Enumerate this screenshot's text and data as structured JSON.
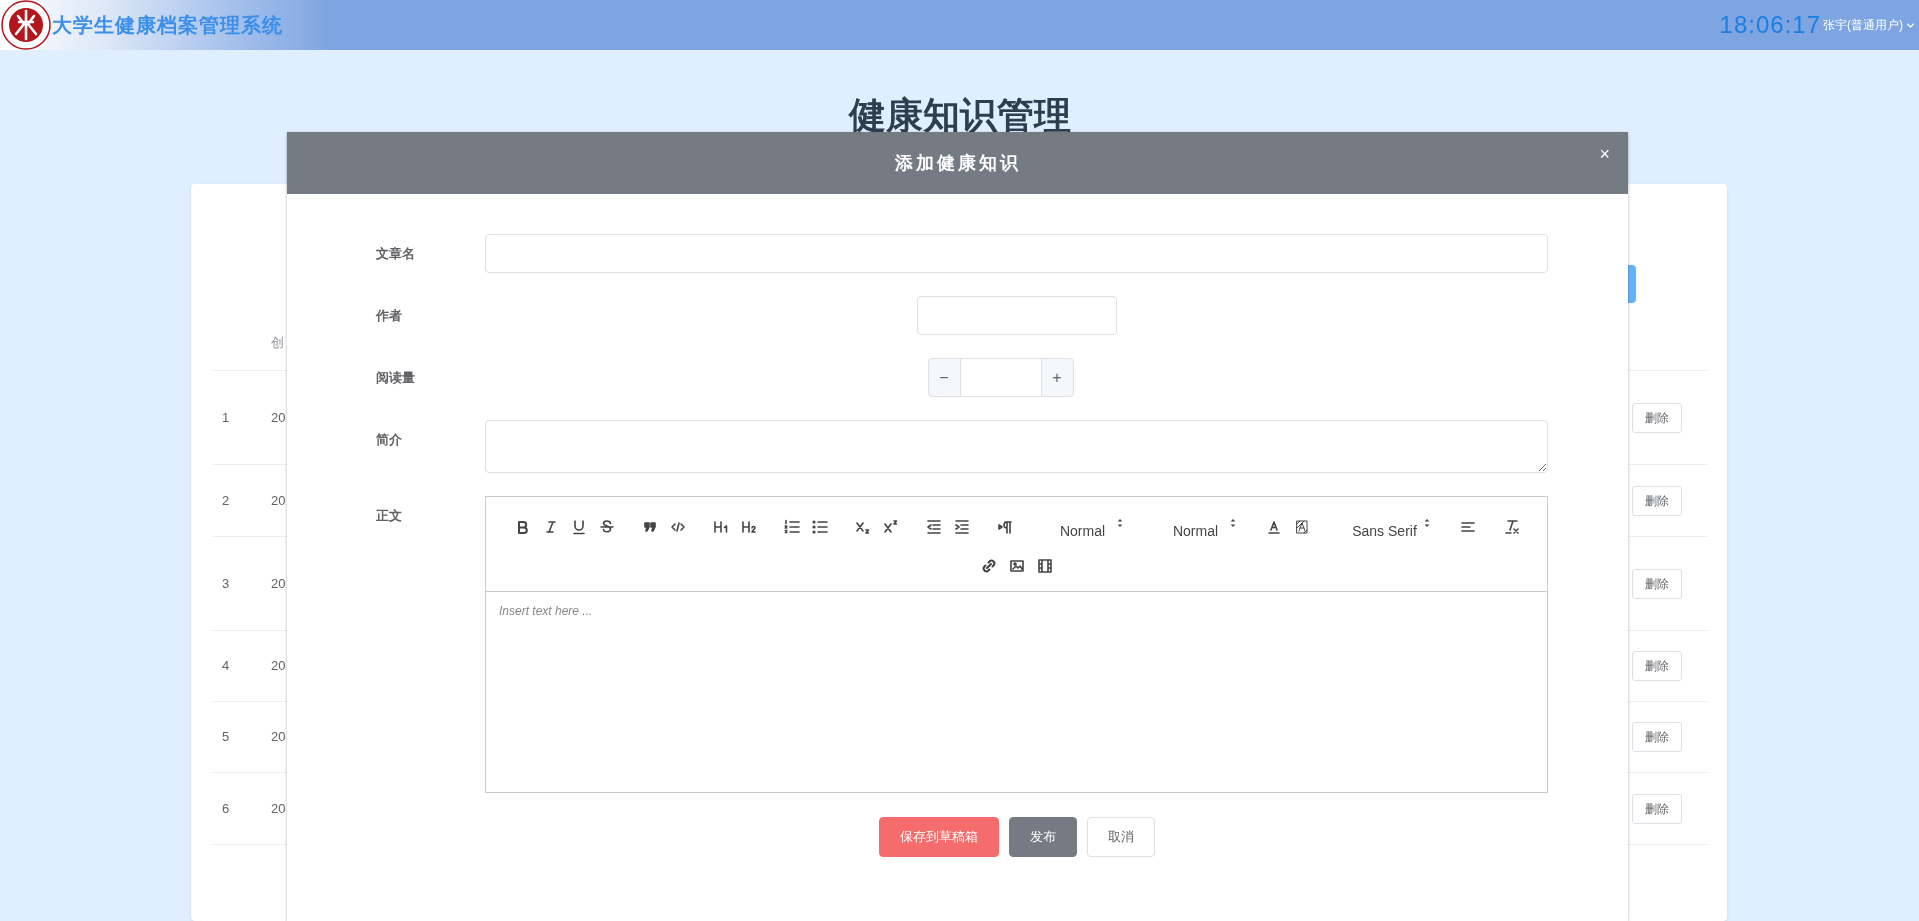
{
  "header": {
    "title": "大学生健康档案管理系统",
    "clock": "18:06:17",
    "user": "张宇(普通用户)"
  },
  "page": {
    "title": "健康知识管理"
  },
  "table": {
    "header_cell": "创",
    "rows": [
      {
        "number": "1",
        "column_2": "20",
        "action": "删除"
      },
      {
        "number": "2",
        "column_2": "20",
        "action": "删除"
      },
      {
        "number": "3",
        "column_2": "20",
        "action": "删除"
      },
      {
        "number": "4",
        "column_2": "20",
        "action": "删除"
      },
      {
        "number": "5",
        "column_2": "20",
        "action": "删除"
      },
      {
        "number": "6",
        "column_2": "20",
        "action": "删除"
      }
    ]
  },
  "dialog": {
    "title": "添加健康知识",
    "close": "×",
    "fields": [
      {
        "kind": "text",
        "label": "文章名"
      },
      {
        "kind": "short",
        "label": "作者"
      },
      {
        "kind": "number",
        "label": "阅读量",
        "minus": "−",
        "plus": "+"
      },
      {
        "kind": "textarea",
        "label": "简介"
      },
      {
        "kind": "editor",
        "label": "正文",
        "pickers": [
          "Normal",
          "Normal",
          "Sans Serif"
        ],
        "placeholder": "Insert text here ..."
      }
    ],
    "buttons": [
      {
        "kind": "danger",
        "label": "保存到草稿箱"
      },
      {
        "kind": "primary",
        "label": "发布"
      },
      {
        "kind": "plain",
        "label": "取消"
      }
    ]
  }
}
